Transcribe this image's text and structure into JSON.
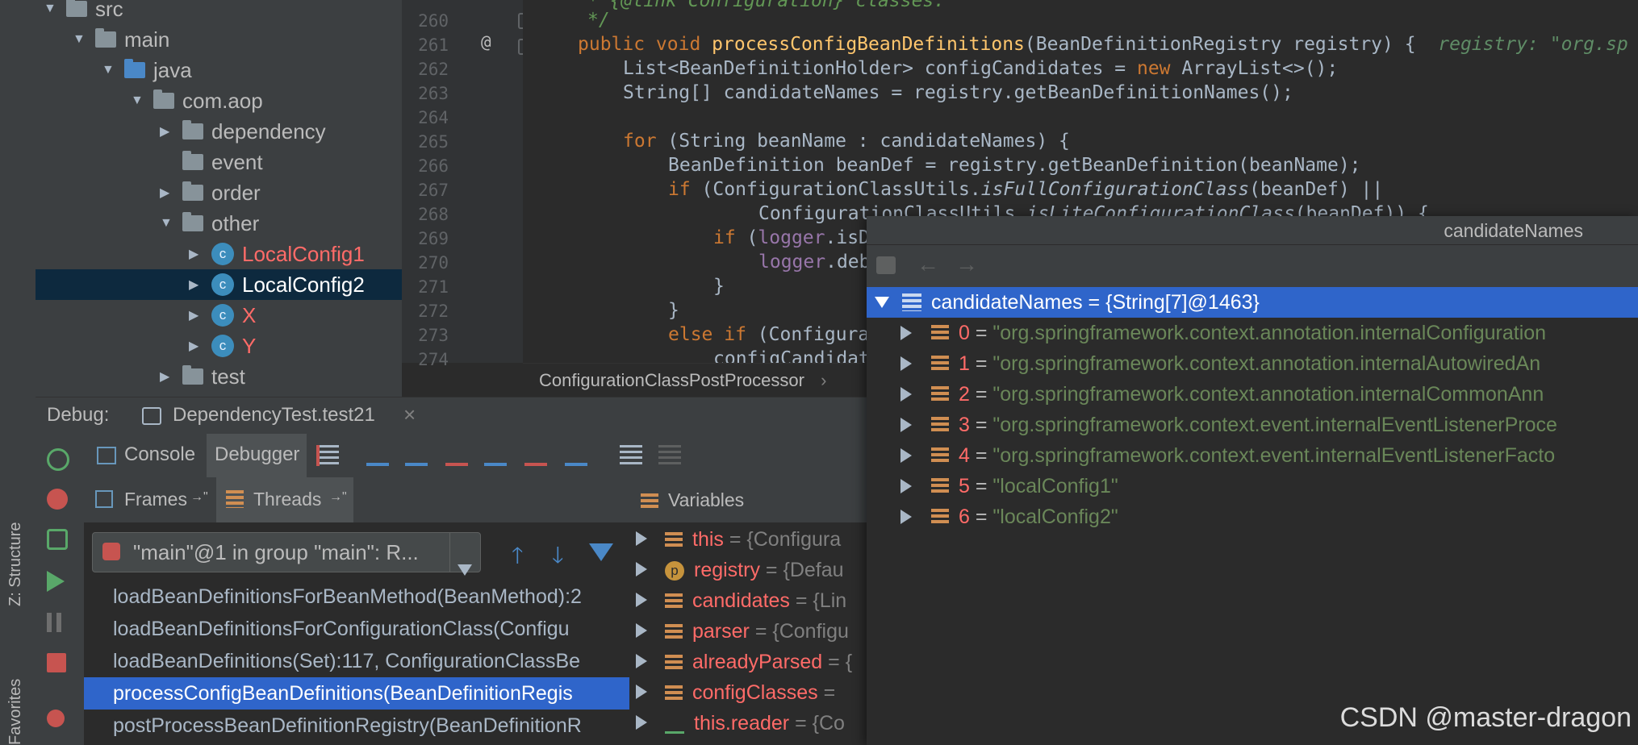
{
  "side_tabs": {
    "structure": "Z: Structure",
    "favorites": "Favorites"
  },
  "tree": {
    "src": "src",
    "main": "main",
    "java": "java",
    "com_aop": "com.aop",
    "dependency": "dependency",
    "event": "event",
    "order": "order",
    "other": "other",
    "localconfig1": "LocalConfig1",
    "localconfig2": "LocalConfig2",
    "x": "X",
    "y": "Y",
    "test": "test",
    "class_letter": "c"
  },
  "editor": {
    "lines": [
      "260",
      "261",
      "262",
      "263",
      "264",
      "265",
      "266",
      "267",
      "268",
      "269",
      "270",
      "271",
      "272",
      "273",
      "274"
    ],
    "comment_top": "* {@link Configuration} classes.",
    "comment_end": "*/",
    "annotation_marker": "@",
    "l261_kw": "public void ",
    "l261_fn": "processConfigBeanDefinitions",
    "l261_rest": "(BeanDefinitionRegistry registry) {",
    "l261_hint": "registry: \"org.sp",
    "l262_a": "List<BeanDefinitionHolder> configCandidates = ",
    "l262_kw": "new",
    "l262_b": " ArrayList<>();",
    "l263": "String[] candidateNames = registry.getBeanDefinitionNames();",
    "l265_kw": "for",
    "l265_rest": " (String beanName : candidateNames) {",
    "l266": "BeanDefinition beanDef = registry.getBeanDefinition(beanName);",
    "l267_kw": "if",
    "l267_a": " (ConfigurationClassUtils.",
    "l267_it": "isFullConfigurationClass",
    "l267_b": "(beanDef) ||",
    "l268_a": "ConfigurationClassUtils.",
    "l268_it": "isLiteConfigurationClass",
    "l268_b": "(beanDef)) {",
    "l269_kw": "if",
    "l269_a": " (",
    "l269_fld": "logger",
    "l269_b": ".isDebugEnabled()) {",
    "l270_fld": "logger",
    "l270_b": ".deb",
    "l271": "}",
    "l272": "}",
    "l273_kw": "else if",
    "l273_b": " (Configura",
    "l274": "configCandidate"
  },
  "breadcrumb": {
    "label": "ConfigurationClassPostProcessor",
    "sep": "›"
  },
  "debug": {
    "label": "Debug:",
    "session": "DependencyTest.test21",
    "close": "×",
    "tab_console": "Console",
    "tab_debugger": "Debugger",
    "frames_label": "Frames",
    "threads_label": "Threads",
    "pin": "→\"",
    "thread_value": "\"main\"@1 in group \"main\": R...",
    "variables_label": "Variables",
    "frames": [
      "loadBeanDefinitionsForBeanMethod(BeanMethod):2",
      "loadBeanDefinitionsForConfigurationClass(Configu",
      "loadBeanDefinitions(Set):117, ConfigurationClassBe",
      "processConfigBeanDefinitions(BeanDefinitionRegis",
      "postProcessBeanDefinitionRegistry(BeanDefinitionR"
    ],
    "variables": [
      {
        "name": "this",
        "value": "= {Configura"
      },
      {
        "name": "registry",
        "value": "= {Defau"
      },
      {
        "name": "candidates",
        "value": "= {Lin"
      },
      {
        "name": "parser",
        "value": "= {Configu"
      },
      {
        "name": "alreadyParsed",
        "value": "= {"
      },
      {
        "name": "configClasses",
        "value": "="
      },
      {
        "name": "this.reader",
        "value": "= {Co"
      }
    ]
  },
  "popup": {
    "title": "candidateNames",
    "root": "candidateNames = {String[7]@1463}",
    "items": [
      {
        "index": "0",
        "value": "\"org.springframework.context.annotation.internalConfiguration"
      },
      {
        "index": "1",
        "value": "\"org.springframework.context.annotation.internalAutowiredAn"
      },
      {
        "index": "2",
        "value": "\"org.springframework.context.annotation.internalCommonAnn"
      },
      {
        "index": "3",
        "value": "\"org.springframework.context.event.internalEventListenerProce"
      },
      {
        "index": "4",
        "value": "\"org.springframework.context.event.internalEventListenerFacto"
      },
      {
        "index": "5",
        "value": "\"localConfig1\""
      },
      {
        "index": "6",
        "value": "\"localConfig2\""
      }
    ],
    "eq": " = "
  },
  "watermark": "CSDN @master-dragon",
  "colors": {
    "selection": "#2f65ca",
    "tree_selection": "#0d293e",
    "red_text": "#ff6b68",
    "string_green": "#6a8759",
    "keyword": "#cc7832"
  }
}
